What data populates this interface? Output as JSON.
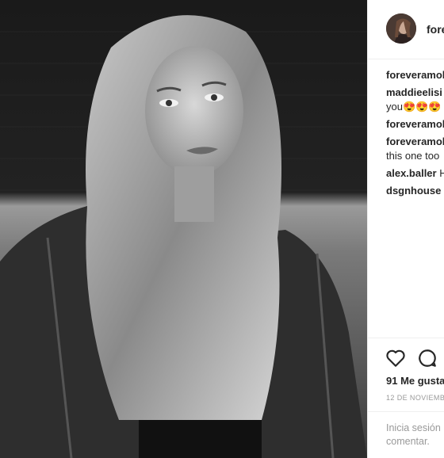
{
  "post": {
    "username": "fore",
    "likes": "91 Me gusta",
    "date": "12 DE NOVIEMB",
    "login_line1": "Inicia sesión",
    "login_line2": "comentar."
  },
  "comments": [
    {
      "user": "foreveramol",
      "text": ""
    },
    {
      "user": "maddieelisi",
      "text": "",
      "cont": "you😍😍😍"
    },
    {
      "user": "foreveramol",
      "text": ""
    },
    {
      "user": "foreveramol",
      "text": "",
      "cont": "this one too"
    },
    {
      "user": "alex.baller",
      "text": "H"
    },
    {
      "user": "dsgnhouse",
      "text": ""
    }
  ],
  "icons": [
    "heart-icon",
    "comment-icon"
  ]
}
